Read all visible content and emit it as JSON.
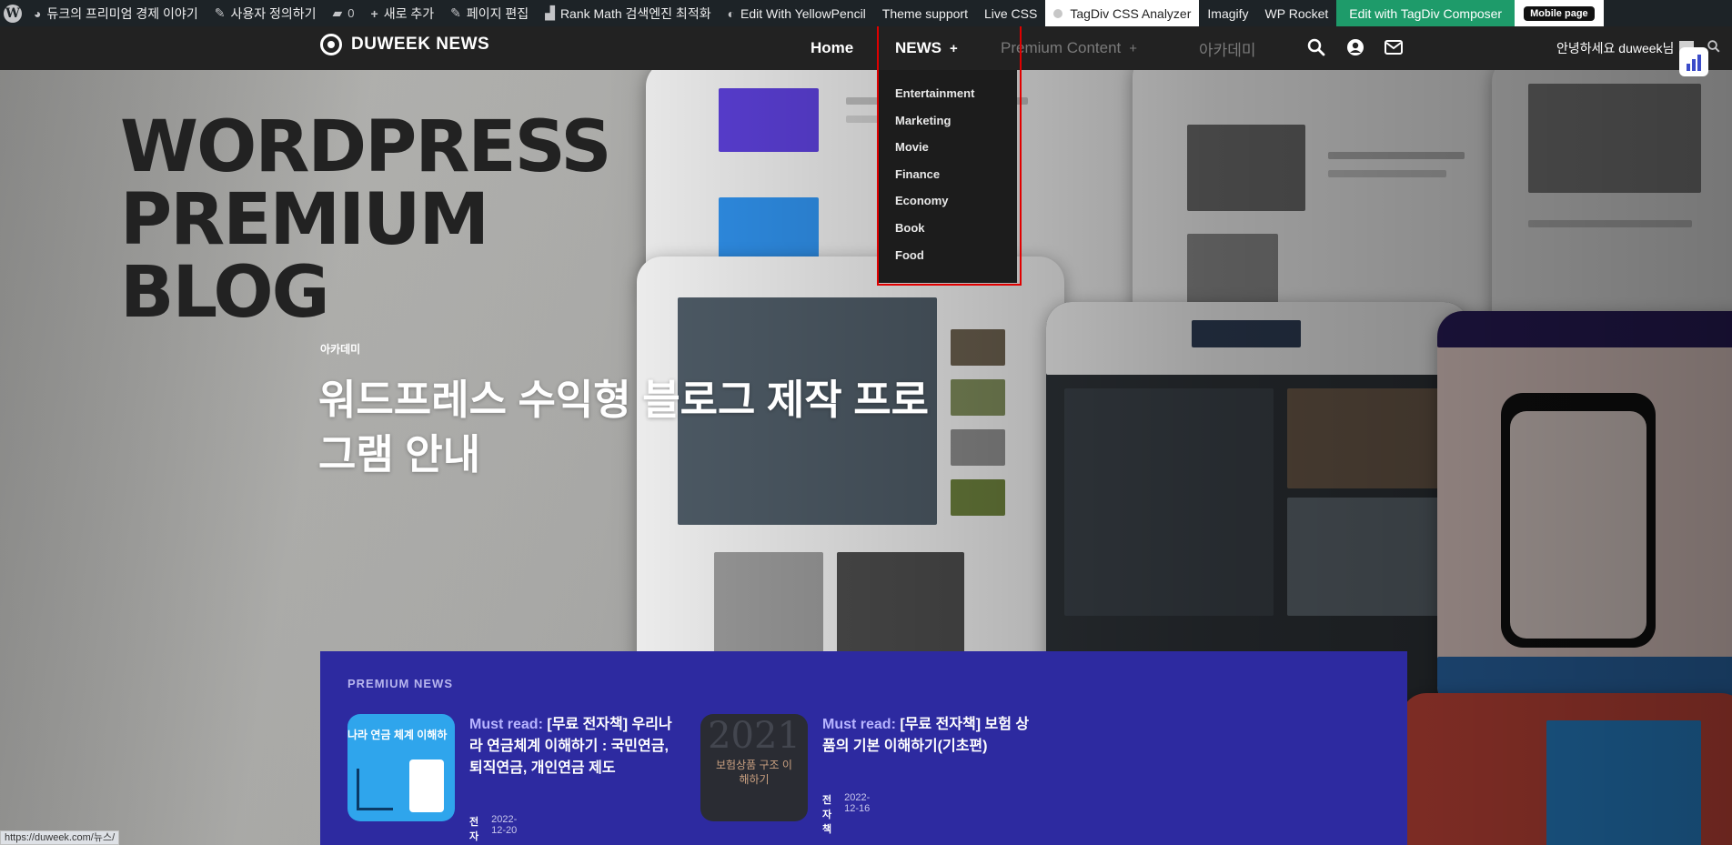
{
  "admin_bar": {
    "wp_logo": "W",
    "site_name": "듀크의 프리미엄 경제 이야기",
    "customize": "사용자 정의하기",
    "comments_count": "0",
    "new_item": "새로 추가",
    "edit_page": "페이지 편집",
    "rank_math": "Rank Math 검색엔진 최적화",
    "yellow_pencil": "Edit With YellowPencil",
    "theme_support": "Theme support",
    "live_css": "Live CSS",
    "tagdiv_css": "TagDiv CSS Analyzer",
    "imagify": "Imagify",
    "wp_rocket": "WP Rocket",
    "tagdiv_composer": "Edit with TagDiv Composer",
    "mobile_page": "Mobile page"
  },
  "header": {
    "logo_text": "DUWEEK NEWS",
    "nav": {
      "home": "Home",
      "news": "NEWS",
      "premium": "Premium Content",
      "academy": "아카데미",
      "plus": "+"
    },
    "greeting": "안녕하세요 duweek님"
  },
  "dropdown": {
    "items": [
      "Entertainment",
      "Marketing",
      "Movie",
      "Finance",
      "Economy",
      "Book",
      "Food"
    ]
  },
  "hero": {
    "big_words": [
      "WORDPRESS",
      "PREMIUM",
      "BLOG"
    ],
    "category": "아카데미",
    "title": "워드프레스 수익형 블로그 제작 프로그램 안내"
  },
  "premium_news": {
    "label": "PREMIUM NEWS",
    "must_read": "Must read:",
    "cards": [
      {
        "title": "[무료 전자책] 우리나라 연금체계 이해하기 : 국민연금, 퇴직연금, 개인연금 제도",
        "thumb_text": "나라 연금 체계 이해하",
        "author": "전자책",
        "date": "2022-12-20"
      },
      {
        "title": "[무료 전자책] 보험 상품의 기본 이해하기(기초편)",
        "thumb_text": "보험상품 구조 이해하기",
        "thumb_year": "2021",
        "author": "전자책",
        "date": "2022-12-16"
      }
    ]
  },
  "status_url": "https://duweek.com/뉴스/",
  "colors": {
    "admin_bar": "#1d2327",
    "header": "#222222",
    "premium_bg": "#2d2aa0",
    "tagdiv_green": "#1e9b6a",
    "highlight_red": "#e00000"
  }
}
